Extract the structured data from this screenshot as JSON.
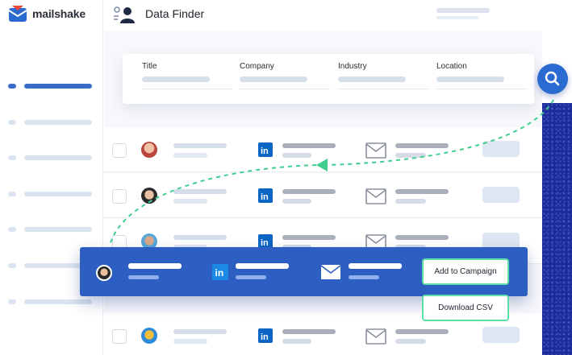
{
  "brand": {
    "name": "mailshake"
  },
  "header": {
    "title": "Data Finder"
  },
  "filters": [
    {
      "label": "Title"
    },
    {
      "label": "Company"
    },
    {
      "label": "Industry"
    },
    {
      "label": "Location"
    }
  ],
  "selected_row": {
    "actions": {
      "add_to_campaign": "Add to Campaign",
      "download_csv": "Download CSV"
    }
  },
  "icons": {
    "search": "search-icon",
    "linkedin": "linkedin-icon",
    "mail": "mail-icon",
    "header": "people-search-icon"
  },
  "colors": {
    "accent": "#2d5fc2",
    "action_border": "#5de0a6",
    "path_line": "#3ecf8e",
    "linkedin": "#0a66c2"
  }
}
